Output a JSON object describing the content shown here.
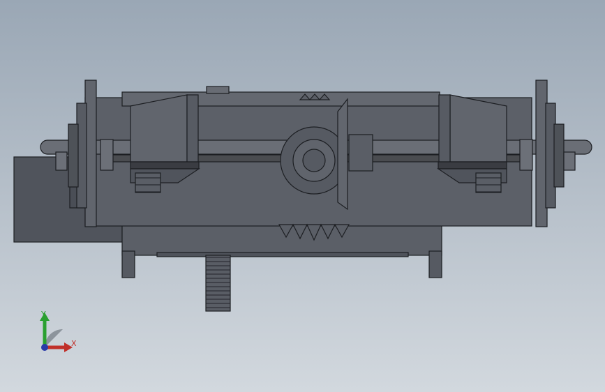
{
  "viewport": {
    "background_top": "#9aa7b5",
    "background_bottom": "#d2d8de"
  },
  "model": {
    "body_color": "#5a5e66",
    "shaft_color": "#6a6e76",
    "edge_color": "#1c1e22",
    "light_color": "#7a7e86"
  },
  "triad": {
    "x_label": "X",
    "y_label": "Y",
    "x_color": "#c0302a",
    "y_color": "#2aa030",
    "z_color": "#2a3aa8"
  }
}
